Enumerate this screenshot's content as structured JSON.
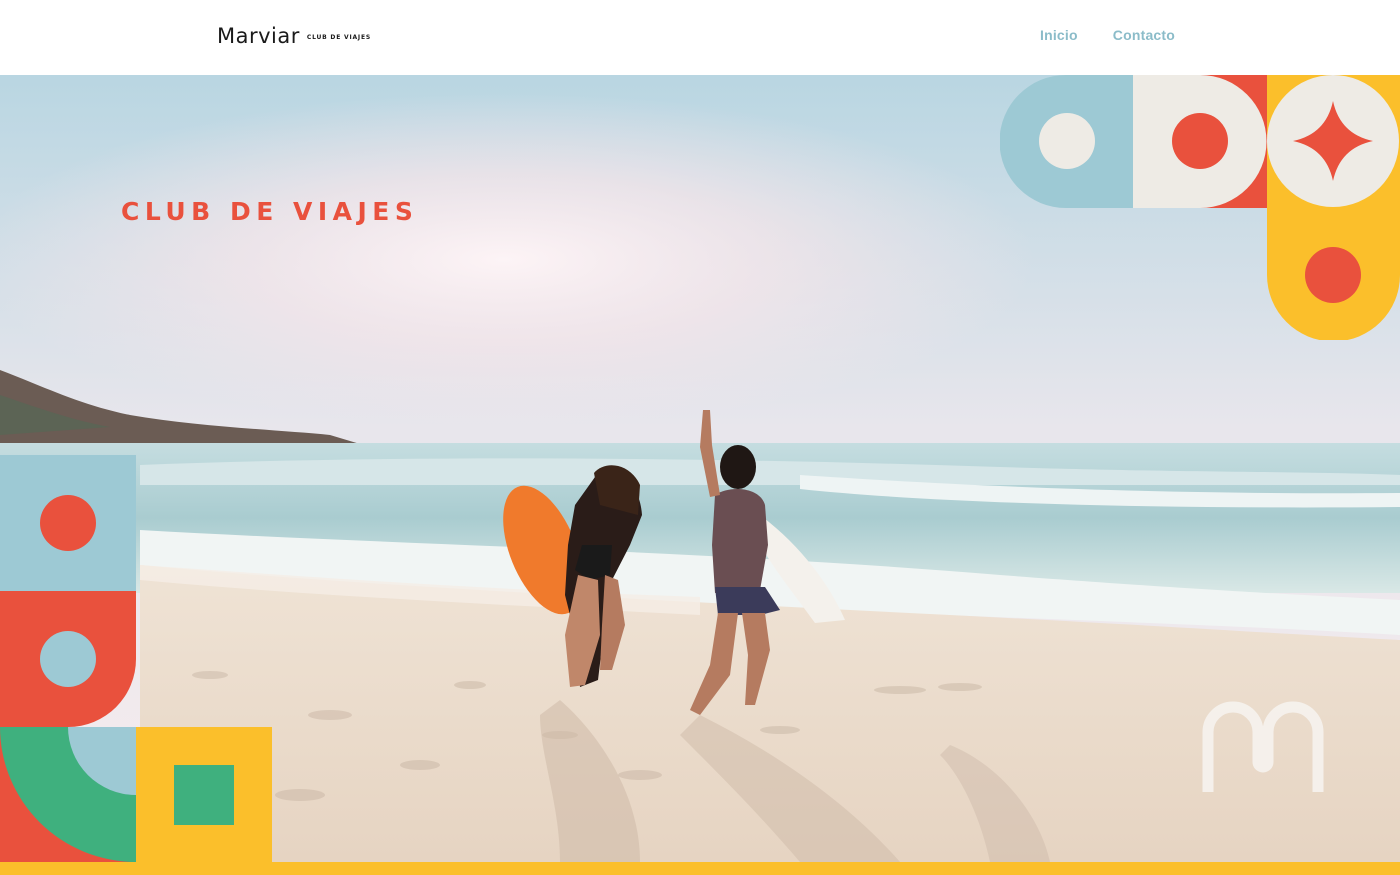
{
  "header": {
    "logo_text": "Marviar",
    "logo_tagline": "CLUB DE VIAJES",
    "nav": [
      {
        "label": "Inicio"
      },
      {
        "label": "Contacto"
      }
    ]
  },
  "hero": {
    "title": "CLUB DE VIAJES",
    "image": "beach-surfers-photo",
    "watermark_icon": "marviar-m-monogram-icon"
  },
  "colors": {
    "coral": "#e9513d",
    "sky_blue": "#9dc9d4",
    "cream": "#eeebe5",
    "yellow": "#fbbf2b",
    "green": "#3fb07e",
    "nav_text": "#8bbcc9"
  }
}
